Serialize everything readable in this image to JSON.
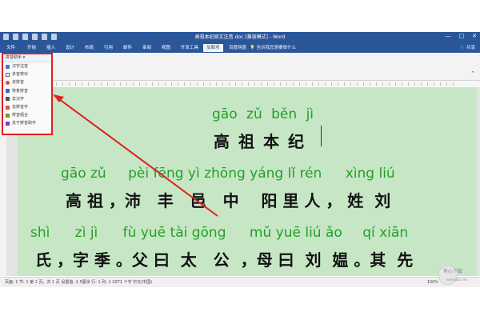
{
  "window": {
    "title": "高祖本纪原文注音.doc [兼容模式] - Word",
    "controls": [
      "—",
      "□",
      "✕"
    ]
  },
  "ribbon": {
    "tabs": [
      "文件",
      "开始",
      "插入",
      "设计",
      "布局",
      "引用",
      "邮件",
      "审阅",
      "视图",
      "开发工具",
      "加载项",
      "百度网盘"
    ],
    "active_tab_index": 10,
    "tell_me": "告诉我您想要做什么",
    "share": "共享"
  },
  "plugin_menu": {
    "title": "拼音助手 ▾",
    "items": [
      {
        "label": "汉字注音",
        "icon": "pinyin-icon"
      },
      {
        "label": "多音校对",
        "icon": "doc-check-icon"
      },
      {
        "label": "去拼音",
        "icon": "remove-icon"
      },
      {
        "label": "恢复拼音",
        "icon": "restore-icon"
      },
      {
        "label": "去汉字",
        "icon": "eraser-icon"
      },
      {
        "label": "去拼音字",
        "icon": "pen-icon"
      },
      {
        "label": "拼音组合",
        "icon": "combine-icon"
      },
      {
        "label": "关于拼音助手",
        "icon": "info-icon"
      }
    ],
    "highlight_color": "#e02020"
  },
  "document": {
    "title_pinyin": [
      "gāo",
      "zǔ",
      "běn",
      "jì"
    ],
    "title_hanzi": [
      "高",
      "祖",
      "本",
      "纪"
    ],
    "line1_pinyin": [
      "gāo zǔ",
      "pèi fēng yì zhōng yáng lǐ rén",
      "xìng liú"
    ],
    "line1_hanzi": "高 祖 ，沛   丰   邑   中    阳 里 人 ， 姓  刘",
    "line2_pinyin": [
      "shì",
      "zì jì",
      "fù yuē tài gōng",
      "mǔ yuē liú ǎo",
      "qí xiān"
    ],
    "line2_hanzi": "氏 ，字 季 。父 曰  太   公  ，母 曰  刘  媪 。其  先",
    "page_color": "#c6e6c6",
    "pinyin_color": "#24a024"
  },
  "statusbar": {
    "left": "页面: 1    节: 1    第 1 页，共 1 页    设置值: 2.5厘米    行: 1    列: 1    2071 个字    中文(中国)",
    "right": "100%"
  },
  "watermark": {
    "text": "有心下载",
    "url": "www.bbx.net"
  }
}
